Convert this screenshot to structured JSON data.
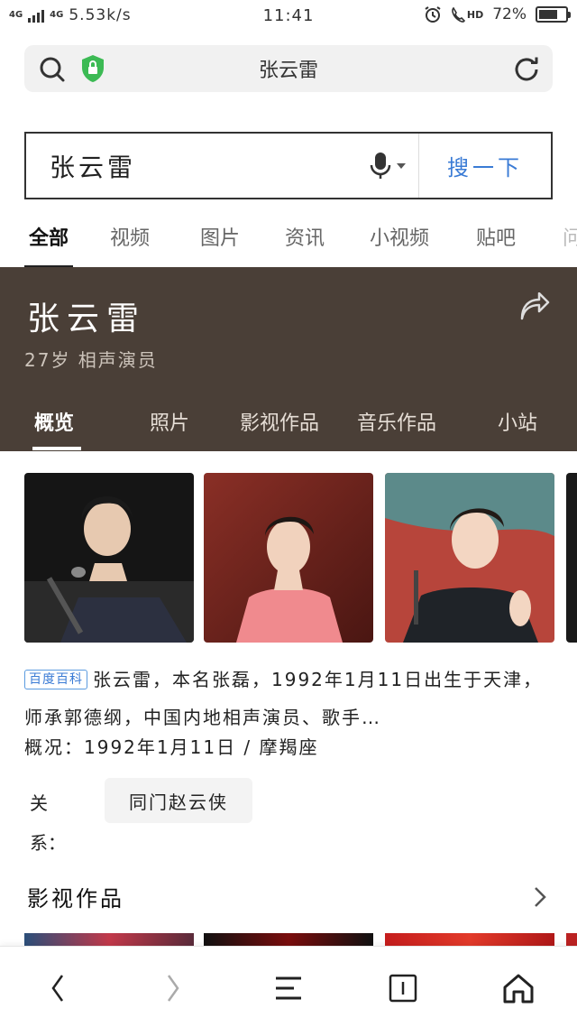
{
  "status_bar": {
    "network": "4G",
    "network2": "4G",
    "speed": "5.53k/s",
    "time": "11:41",
    "hd": "HD",
    "battery_percent": "72%",
    "battery_level": 0.72
  },
  "address_bar": {
    "title": "张云雷"
  },
  "search": {
    "query": "张云雷",
    "button_label": "搜一下"
  },
  "category_tabs": [
    {
      "label": "全部",
      "active": true
    },
    {
      "label": "视频"
    },
    {
      "label": "图片"
    },
    {
      "label": "资讯"
    },
    {
      "label": "小视频"
    },
    {
      "label": "贴吧"
    },
    {
      "label": "问"
    }
  ],
  "hero": {
    "name": "张云雷",
    "subtitle": "27岁 相声演员",
    "tabs": [
      {
        "label": "概览",
        "active": true
      },
      {
        "label": "照片"
      },
      {
        "label": "影视作品"
      },
      {
        "label": "音乐作品"
      },
      {
        "label": "小站"
      }
    ]
  },
  "summary": {
    "badge": "百度百科",
    "text": "张云雷，本名张磊，1992年1月11日出生于天津，师承郭德纲，中国内地相声演员、歌手…",
    "overview": "概况：1992年1月11日 / 摩羯座",
    "relation_label": "关系：",
    "relation_chip": "同门赵云侠"
  },
  "works": {
    "title": "影视作品"
  }
}
